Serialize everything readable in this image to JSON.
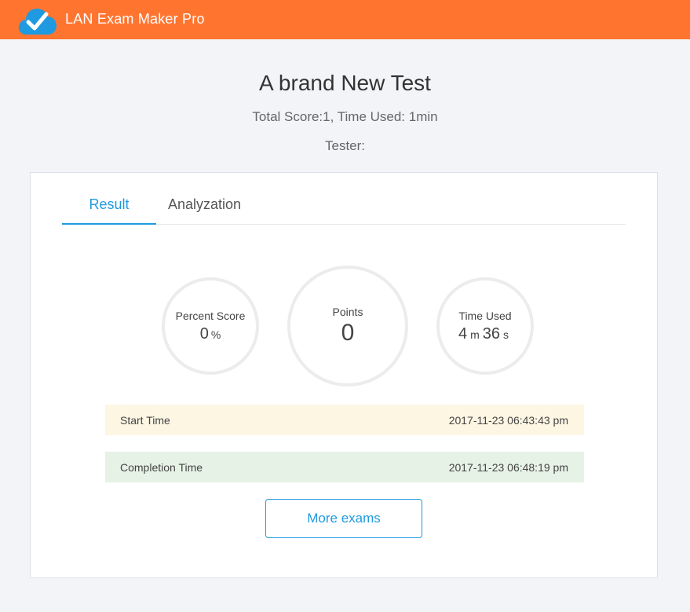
{
  "app": {
    "title": "LAN Exam Maker Pro"
  },
  "test": {
    "title": "A brand New Test",
    "score_line": "Total Score:1, Time Used: 1min",
    "tester_line": "Tester:"
  },
  "tabs": [
    {
      "label": "Result",
      "active": true
    },
    {
      "label": "Analyzation",
      "active": false
    }
  ],
  "stats": {
    "percent": {
      "label": "Percent Score",
      "value": "0",
      "unit": "%"
    },
    "points": {
      "label": "Points",
      "value": "0"
    },
    "time": {
      "label": "Time Used",
      "minutes": "4",
      "minutes_unit": "m",
      "seconds": "36",
      "seconds_unit": "s"
    }
  },
  "times": {
    "start": {
      "label": "Start Time",
      "value": "2017-11-23 06:43:43 pm"
    },
    "completion": {
      "label": "Completion Time",
      "value": "2017-11-23 06:48:19 pm"
    }
  },
  "actions": {
    "more_exams": "More exams"
  },
  "colors": {
    "header": "#ff7530",
    "accent": "#1f9ae0",
    "start_row": "#fdf6e3",
    "completion_row": "#e6f2e6",
    "logo_cloud": "#1f9ae0"
  },
  "icons": {
    "logo": "cloud-check-icon"
  }
}
